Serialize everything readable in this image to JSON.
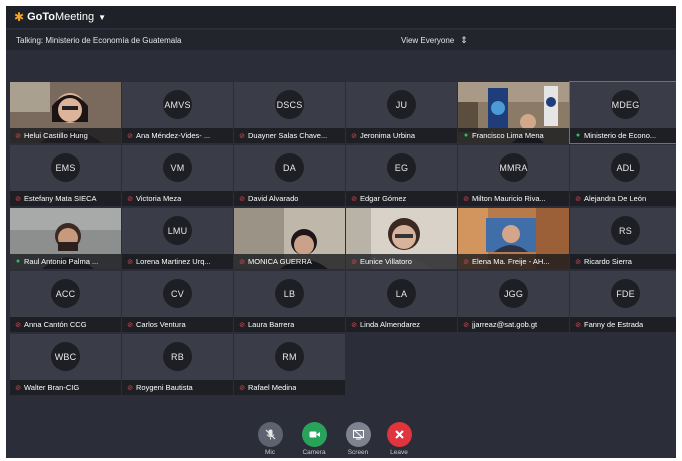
{
  "app": {
    "brand_prefix": "GoTo",
    "brand_suffix": "Meeting"
  },
  "info": {
    "talking": "Talking: Ministerio de Economía de Guatemala",
    "view": "View Everyone"
  },
  "participants": [
    {
      "name": "Helui Castillo Hung",
      "initials": "",
      "mic": "muted",
      "video": true
    },
    {
      "name": "Ana Méndez-Vides- ...",
      "initials": "AMVS",
      "mic": "muted",
      "video": false
    },
    {
      "name": "Duayner Salas Chave...",
      "initials": "DSCS",
      "mic": "muted",
      "video": false
    },
    {
      "name": "Jeronima Urbina",
      "initials": "JU",
      "mic": "muted",
      "video": false
    },
    {
      "name": "Francisco Lima Mena",
      "initials": "",
      "mic": "active",
      "video": true
    },
    {
      "name": "Ministerio de Econo...",
      "initials": "MDEG",
      "mic": "active",
      "video": false
    },
    {
      "name": "Estefany Mata SIECA",
      "initials": "EMS",
      "mic": "muted",
      "video": false
    },
    {
      "name": "Victoria Meza",
      "initials": "VM",
      "mic": "muted",
      "video": false
    },
    {
      "name": "David Alvarado",
      "initials": "DA",
      "mic": "muted",
      "video": false
    },
    {
      "name": "Edgar Gómez",
      "initials": "EG",
      "mic": "muted",
      "video": false
    },
    {
      "name": "Milton Mauricio Riva...",
      "initials": "MMRA",
      "mic": "muted",
      "video": false
    },
    {
      "name": "Alejandra De León",
      "initials": "ADL",
      "mic": "muted",
      "video": false
    },
    {
      "name": "Raul Antonio Palma ...",
      "initials": "",
      "mic": "active",
      "video": true
    },
    {
      "name": "Lorena Martinez Urq...",
      "initials": "LMU",
      "mic": "muted",
      "video": false
    },
    {
      "name": "MONICA GUERRA",
      "initials": "",
      "mic": "muted",
      "video": true
    },
    {
      "name": "Eunice Villatoro",
      "initials": "",
      "mic": "muted",
      "video": true
    },
    {
      "name": "Elena Ma. Freije - AH...",
      "initials": "",
      "mic": "muted",
      "video": true
    },
    {
      "name": "Ricardo Sierra",
      "initials": "RS",
      "mic": "muted",
      "video": false
    },
    {
      "name": "Anna Cantón CCG",
      "initials": "ACC",
      "mic": "muted",
      "video": false
    },
    {
      "name": "Carlos Ventura",
      "initials": "CV",
      "mic": "muted",
      "video": false
    },
    {
      "name": "Laura Barrera",
      "initials": "LB",
      "mic": "muted",
      "video": false
    },
    {
      "name": "Linda Almendarez",
      "initials": "LA",
      "mic": "muted",
      "video": false
    },
    {
      "name": "jjarreaz@sat.gob.gt",
      "initials": "JGG",
      "mic": "muted",
      "video": false
    },
    {
      "name": "Fanny de Estrada",
      "initials": "FDE",
      "mic": "muted",
      "video": false
    },
    {
      "name": "Walter Bran-CIG",
      "initials": "WBC",
      "mic": "muted",
      "video": false
    },
    {
      "name": "Roygeni Bautista",
      "initials": "RB",
      "mic": "muted",
      "video": false
    },
    {
      "name": "Rafael Medina",
      "initials": "RM",
      "mic": "muted",
      "video": false
    }
  ],
  "controls": [
    {
      "label": "Mic",
      "icon": "mic-off-icon",
      "color": "#5f636f"
    },
    {
      "label": "Camera",
      "icon": "camera-icon",
      "color": "#27a35a"
    },
    {
      "label": "Screen",
      "icon": "screen-share-icon",
      "color": "#7f8390"
    },
    {
      "label": "Leave",
      "icon": "close-icon",
      "color": "#e0343f"
    }
  ]
}
